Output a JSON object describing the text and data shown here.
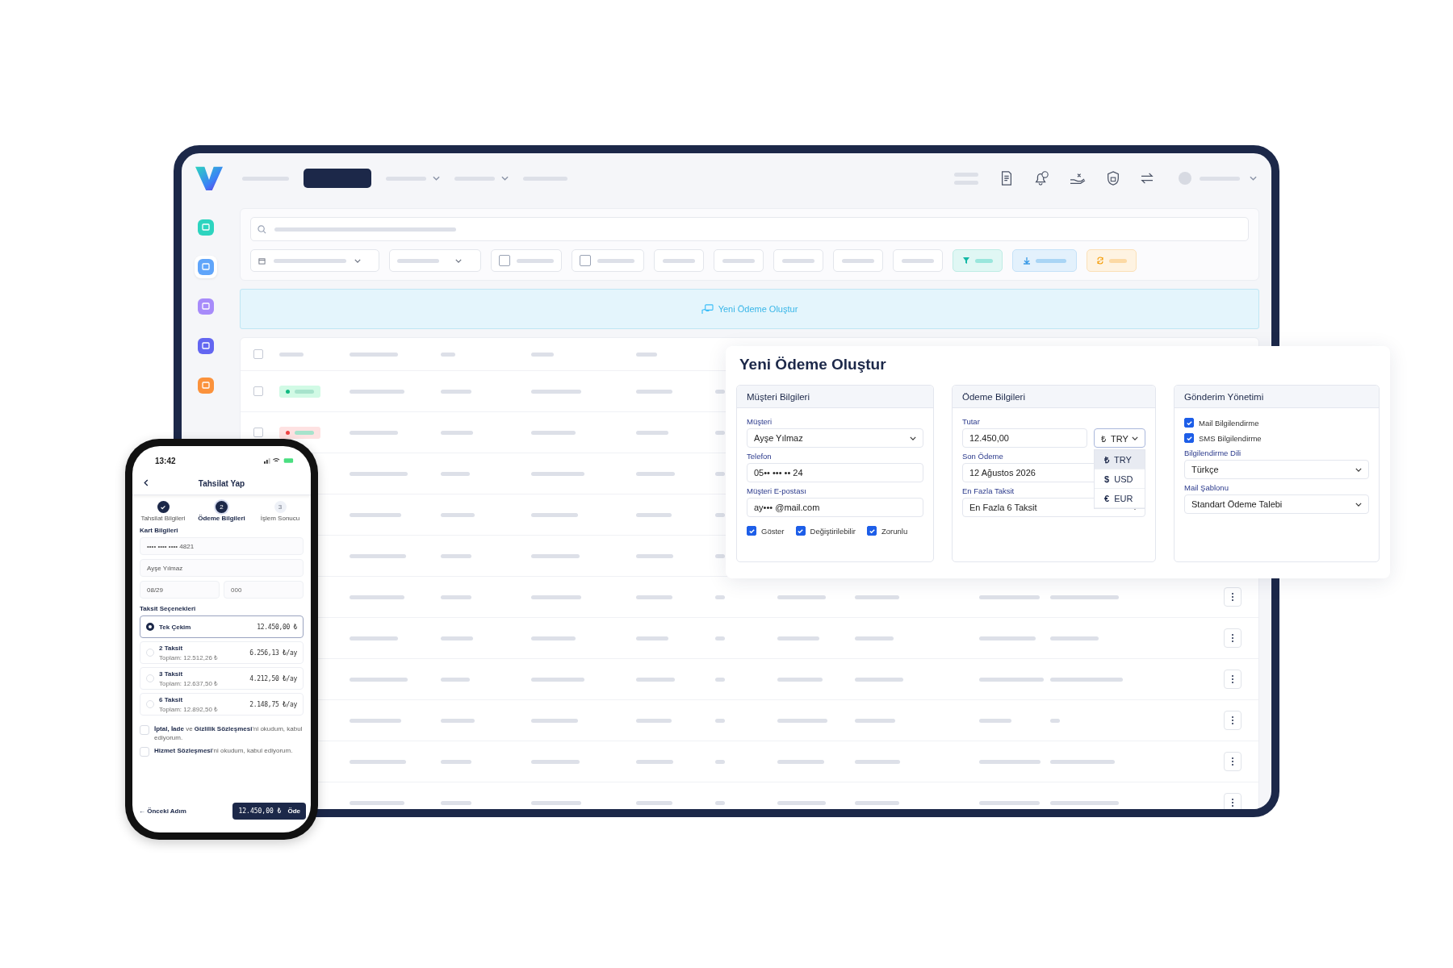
{
  "sidebar": [
    {
      "color": "#2dd4bf",
      "selected": false
    },
    {
      "color": "#60a5fa",
      "selected": true
    },
    {
      "color": "#a78bfa",
      "selected": false
    },
    {
      "color": "#6366f1",
      "selected": false
    },
    {
      "color": "#fb923c",
      "selected": false
    }
  ],
  "banner": {
    "label": "Yeni Ödeme Oluştur"
  },
  "row_checkboxes": [
    {
      "checked": false
    },
    {
      "checked": false
    },
    {
      "checked": false
    }
  ],
  "dialog": {
    "title": "Yeni Ödeme Oluştur",
    "sections": [
      {
        "title": "Müşteri Bilgileri",
        "items": [
          {
            "kind": "select",
            "label": "Müşteri",
            "value": "Ayşe Yılmaz"
          },
          {
            "kind": "text",
            "label": "Telefon",
            "value": "05•• ••• •• 24"
          },
          {
            "kind": "text",
            "label": "Müşteri E-postası",
            "value": "ay••• @mail.com"
          },
          {
            "kind": "checks",
            "checks": [
              {
                "label": "Göster",
                "checked": true
              },
              {
                "label": "Değiştirilebilir",
                "checked": true
              },
              {
                "label": "Zorunlu",
                "checked": true
              }
            ]
          }
        ]
      },
      {
        "title": "Ödeme Bilgileri",
        "items": [
          {
            "kind": "amount",
            "label": "Tutar",
            "value": "12.450,00",
            "currency": {
              "symbol": "₺",
              "code": "TRY",
              "expanded": true,
              "options": [
                {
                  "symbol": "₺",
                  "code": "TRY",
                  "selected": true
                },
                {
                  "symbol": "$",
                  "code": "USD",
                  "selected": false
                },
                {
                  "symbol": "€",
                  "code": "EUR",
                  "selected": false
                }
              ]
            }
          },
          {
            "kind": "text",
            "label": "Son Ödeme",
            "value": "12 Ağustos 2026"
          },
          {
            "kind": "select",
            "label": "En Fazla Taksit",
            "value": "En Fazla 6 Taksit"
          }
        ]
      },
      {
        "title": "Gönderim Yönetimi",
        "items": [
          {
            "kind": "check",
            "label": "Mail Bilgilendirme",
            "checked": true
          },
          {
            "kind": "check",
            "label": "SMS Bilgilendirme",
            "checked": true
          },
          {
            "kind": "select",
            "label": "Bilgilendirme Dili",
            "value": "Türkçe"
          },
          {
            "kind": "select",
            "label": "Mail Şablonu",
            "value": "Standart Ödeme Talebi"
          }
        ]
      }
    ]
  },
  "phone": {
    "time": "13:42",
    "title": "Tahsilat Yap",
    "steps": [
      {
        "label": "Tahsilat Bilgileri",
        "completed": true,
        "selected": false
      },
      {
        "label": "Ödeme Bilgileri",
        "number": "2",
        "completed": false,
        "selected": true
      },
      {
        "label": "İşlem Sonucu",
        "number": "3",
        "completed": false,
        "selected": false
      }
    ],
    "card_title": "Kart Bilgileri",
    "card_fields": [
      {
        "value": "•••• •••• •••• 4821"
      },
      {
        "value": "Ayşe Yılmaz"
      }
    ],
    "expiry": {
      "value": "08/29"
    },
    "cvv": {
      "placeholder": "000"
    },
    "installments_title": "Taksit Seçenekleri",
    "installments": [
      {
        "label": "Tek Çekim",
        "amount": "12.450,00 ₺",
        "selected": true
      },
      {
        "label": "2 Taksit",
        "total": "Toplam: 12.512,26 ₺",
        "amount": "6.256,13 ₺/ay",
        "selected": false
      },
      {
        "label": "3 Taksit",
        "total": "Toplam: 12.637,50 ₺",
        "amount": "4.212,50 ₺/ay",
        "selected": false
      },
      {
        "label": "6 Taksit",
        "total": "Toplam: 12.892,50 ₺",
        "amount": "2.148,75 ₺/ay",
        "selected": false
      }
    ],
    "agreements": [
      {
        "text": "**İptal, İade** ve **Gizlilik Sözleşmesi**'ni okudum, kabul ediyorum.",
        "checked": false
      },
      {
        "text": "**Hizmet Sözleşmesi**'ni okudum, kabul ediyorum.",
        "checked": false
      }
    ],
    "back": "← Önceki Adım",
    "pay_button": {
      "amount": "12.450,00 ₺",
      "label": "Öde"
    }
  }
}
